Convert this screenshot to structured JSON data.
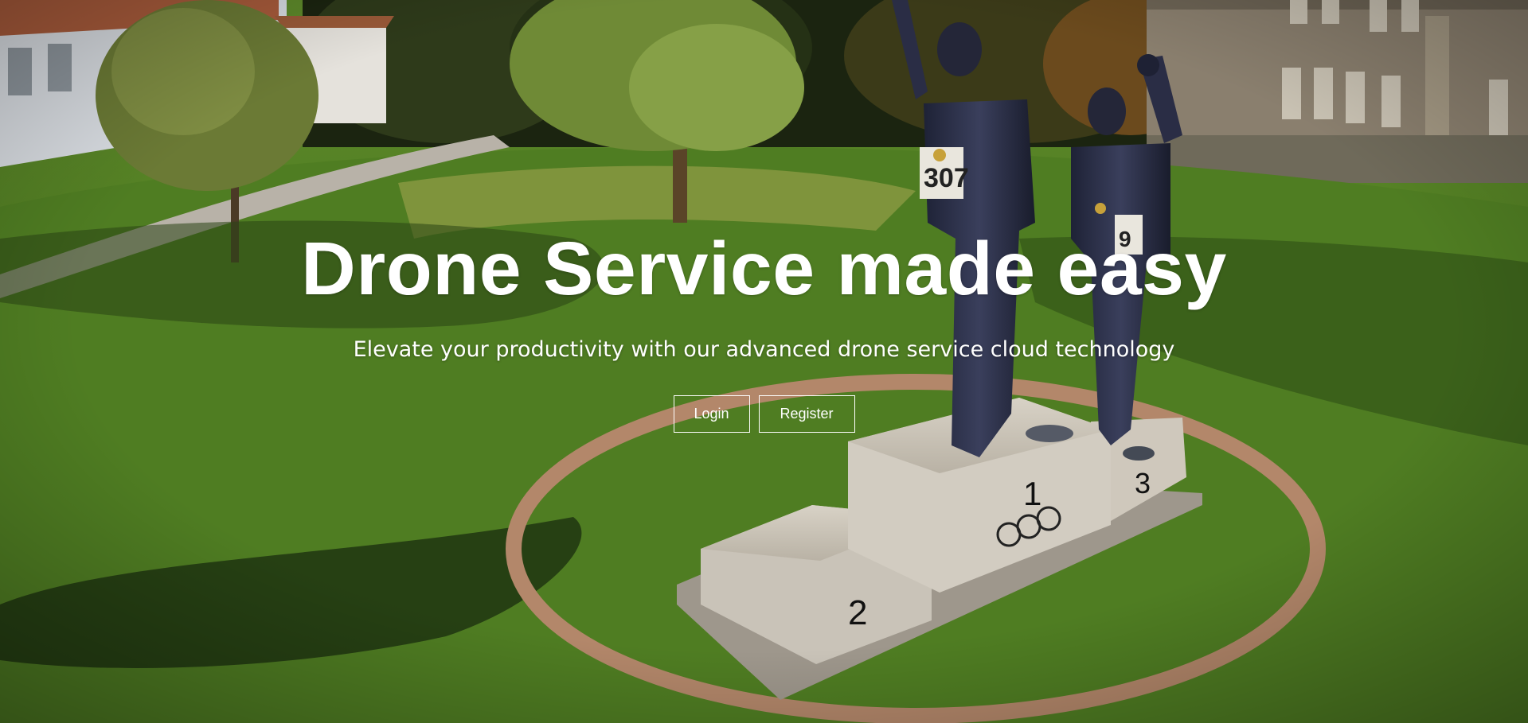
{
  "hero": {
    "title": "Drone Service made easy",
    "subtitle": "Elevate your productivity with our advanced drone service cloud technology",
    "buttons": {
      "login_label": "Login",
      "register_label": "Register"
    },
    "background_description_colors": {
      "grass": "#4f7a22",
      "path": "#b9a08a",
      "text": "#ffffff"
    }
  }
}
